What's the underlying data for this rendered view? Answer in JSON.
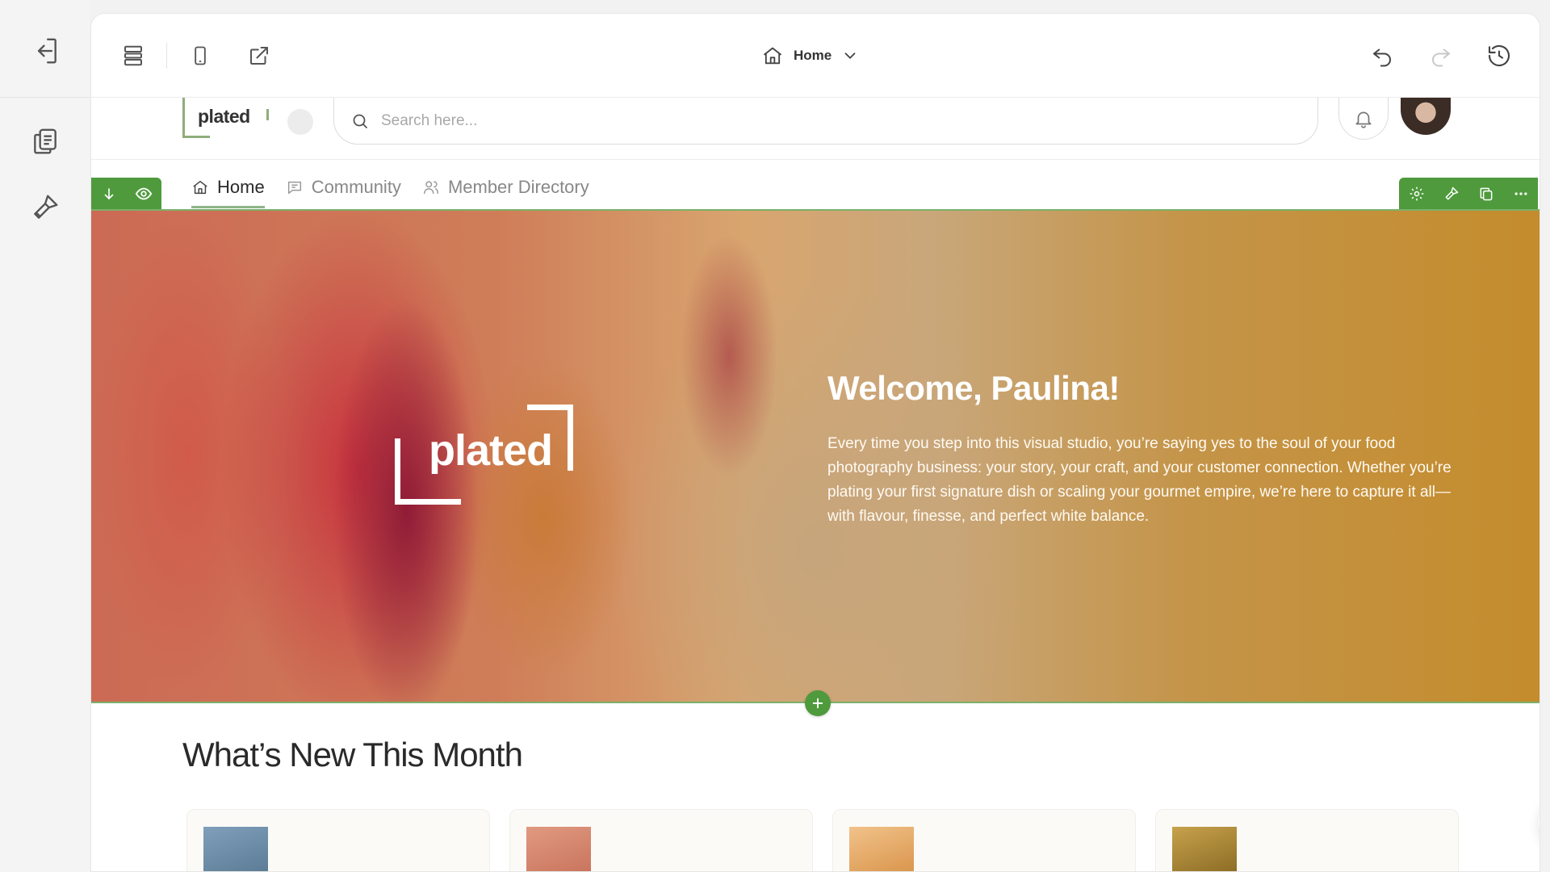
{
  "editor": {
    "rail": {
      "exit_icon": "exit-icon",
      "pages_icon": "pages-icon",
      "design_icon": "brush-icon"
    },
    "toolbar": {
      "layers_icon": "layers-icon",
      "mobile_icon": "mobile-icon",
      "open_icon": "external-link-icon",
      "page_label": "Home",
      "undo_icon": "undo-icon",
      "redo_icon": "redo-icon",
      "history_icon": "history-icon"
    }
  },
  "site": {
    "logo_text": "plated",
    "search": {
      "placeholder": "Search here..."
    },
    "nav": [
      {
        "label": "Home",
        "icon": "home-icon",
        "active": true
      },
      {
        "label": "Community",
        "icon": "chat-icon",
        "active": false
      },
      {
        "label": "Member Directory",
        "icon": "people-icon",
        "active": false
      }
    ],
    "hero": {
      "logo_text": "plated",
      "title": "Welcome, Paulina!",
      "body": "Every time you step into this visual studio, you’re saying yes to the soul of your food photography business: your story, your craft, and your customer connection. Whether you’re plating your first signature dish or scaling your gourmet empire, we’re here to capture it all—with flavour, finesse, and perfect white balance."
    },
    "section_title": "What’s New This Month",
    "cards": [
      {
        "thumb_color": "#6b8ca8"
      },
      {
        "thumb_color": "#d98a74"
      },
      {
        "thumb_color": "#e0a85e"
      },
      {
        "thumb_color": "#a8853a"
      }
    ]
  },
  "colors": {
    "accent_green": "#4e9a3c",
    "hero_gold": "#c48c2c",
    "hero_red": "#8f1c37"
  }
}
